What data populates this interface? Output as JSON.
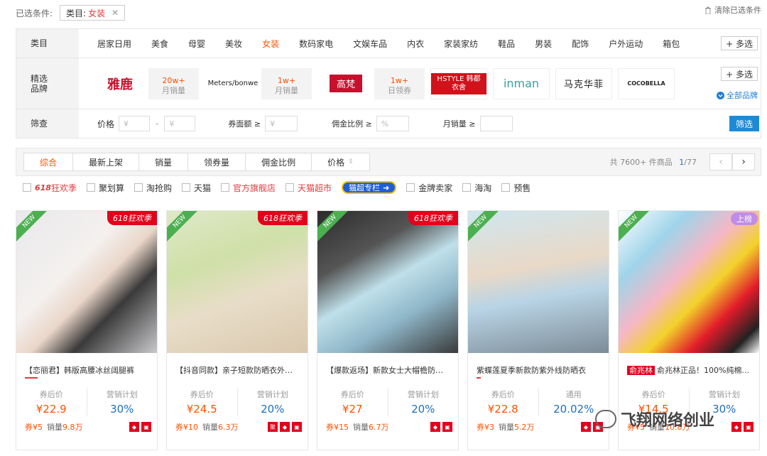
{
  "conditions": {
    "label": "已选条件:",
    "tag_key": "类目:",
    "tag_value": "女装",
    "tag_close": "✕",
    "clear_all": "清除已选条件"
  },
  "filter": {
    "category_head": "类目",
    "categories": [
      "居家日用",
      "美食",
      "母婴",
      "美妆",
      "女装",
      "数码家电",
      "文娱车品",
      "内衣",
      "家装家纺",
      "鞋品",
      "男装",
      "配饰",
      "户外运动",
      "箱包"
    ],
    "active_category": "女装",
    "multi_label": "+ 多选",
    "brand_head_1": "精选",
    "brand_head_2": "品牌",
    "brands": [
      {
        "logo": "雅鹿",
        "count": "20w+",
        "stat": "月销量"
      },
      {
        "logo": "Meters/bonwe",
        "count": "1w+",
        "stat": "月销量"
      },
      {
        "logo": "高梵",
        "count": "1w+",
        "stat": "日领券"
      }
    ],
    "small_brands": [
      "HSTYLE 韩都衣舍",
      "inman",
      "马克华菲",
      "COCOBELLA"
    ],
    "all_brands": "全部品牌",
    "screen_head": "筛查",
    "price_label": "价格",
    "price_placeholder": "¥",
    "dash": "-",
    "coupon_label": "券面额 ≥",
    "commission_label": "佣金比例 ≥",
    "commission_placeholder": "%",
    "monthly_label": "月销量 ≥",
    "screen_button": "筛选"
  },
  "sort": {
    "tabs": [
      "综合",
      "最新上架",
      "销量",
      "领券量",
      "佣金比例",
      "价格"
    ],
    "price_arrow": "⇕",
    "total_prefix": "共 7600+ 件商品",
    "page_current": "1",
    "page_total": "/77",
    "prev": "‹",
    "next": "›"
  },
  "checks": {
    "festival_logo": "618",
    "festival_text": "狂欢季",
    "items": [
      "聚划算",
      "淘抢购",
      "天猫"
    ],
    "flagship": "官方旗舰店",
    "supermarket": "天猫超市",
    "special": "猫超专栏",
    "items2": [
      "金牌卖家",
      "海淘",
      "预售"
    ]
  },
  "products": [
    {
      "title": "【恋丽君】韩版高腰冰丝阔腿裤",
      "after_coupon_label": "券后价",
      "price": "¥22.9",
      "plan_label": "营销计划",
      "rate": "30%",
      "coupon": "券¥5",
      "sales_label": "销量",
      "sales": "9.8万",
      "promo": "618狂欢季"
    },
    {
      "title": "【抖音同款】亲子短款防晒衣外套女",
      "after_coupon_label": "券后价",
      "price": "¥24.5",
      "plan_label": "营销计划",
      "rate": "20%",
      "coupon": "券¥10",
      "sales_label": "销量",
      "sales": "6.3万",
      "promo": "618狂欢季"
    },
    {
      "title": "【爆款返场】新款女士大帽檐防晒...",
      "after_coupon_label": "券后价",
      "price": "¥27",
      "plan_label": "营销计划",
      "rate": "20%",
      "coupon": "券¥15",
      "sales_label": "销量",
      "sales": "6.7万",
      "promo": "618狂欢季"
    },
    {
      "title": "紫蝶莲夏季新款防紫外线防晒衣",
      "after_coupon_label": "券后价",
      "price": "¥22.8",
      "plan_label": "通用",
      "rate": "20.02%",
      "coupon": "券¥3",
      "sales_label": "销量",
      "sales": "5.2万",
      "promo": ""
    },
    {
      "title": "俞兆林正品！100%纯棉...",
      "brand_chip": "俞兆林",
      "after_coupon_label": "券后价",
      "price": "¥14.5",
      "plan_label": "营销计划",
      "rate": "30%",
      "coupon": "券¥5",
      "sales_label": "销量",
      "sales": "10.8万",
      "rank": "上榜"
    }
  ],
  "new_label": "NEW",
  "watermark": "飞翔网络创业"
}
